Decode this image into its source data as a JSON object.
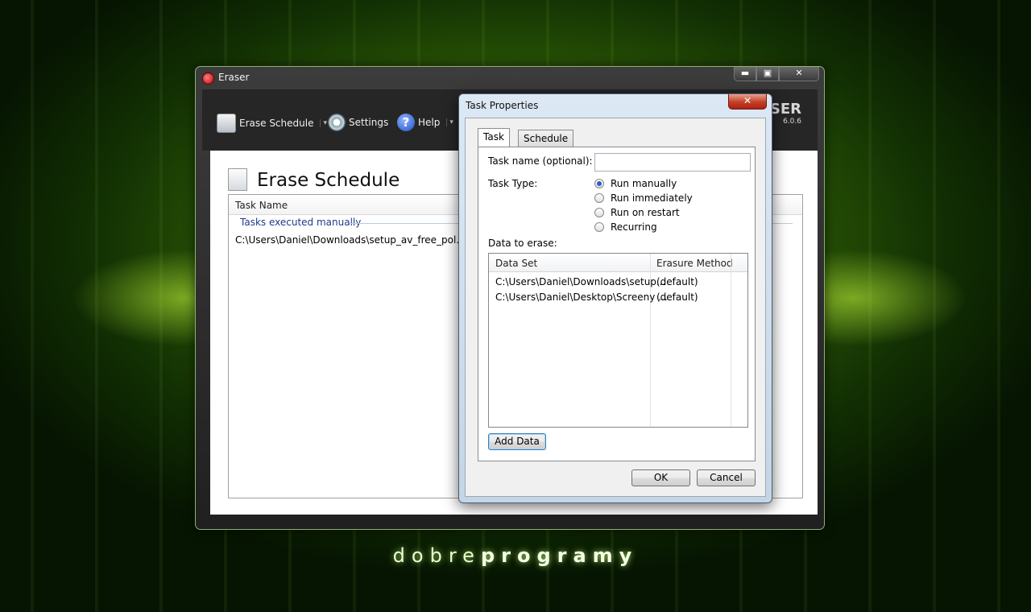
{
  "desktop": {
    "brand_light": "dobre",
    "brand_bold": "programy"
  },
  "main_window": {
    "title": "Eraser",
    "window_buttons": {
      "minimize": "▬",
      "maximize": "▣",
      "close": "✕"
    },
    "toolbar": {
      "erase_schedule": "Erase Schedule",
      "settings": "Settings",
      "help": "Help",
      "dropdown_arrow": "▾"
    },
    "logo": {
      "text": "ASER",
      "version": "6.0.6"
    },
    "page_title": "Erase Schedule",
    "list": {
      "column_task_name": "Task Name",
      "group_label": "Tasks executed manually",
      "rows": [
        "C:\\Users\\Daniel\\Downloads\\setup_av_free_pol.exe"
      ]
    }
  },
  "dialog": {
    "title": "Task Properties",
    "close": "✕",
    "tabs": [
      "Task",
      "Schedule"
    ],
    "task_name_label": "Task name (optional):",
    "task_name_value": "",
    "task_type_label": "Task Type:",
    "task_types": [
      "Run manually",
      "Run immediately",
      "Run on restart",
      "Recurring"
    ],
    "selected_task_type": "Run manually",
    "data_to_erase_label": "Data to erase:",
    "grid": {
      "columns": [
        "Data Set",
        "Erasure Method"
      ],
      "rows": [
        {
          "data_set": "C:\\Users\\Daniel\\Downloads\\setup...",
          "method": "(default)"
        },
        {
          "data_set": "C:\\Users\\Daniel\\Desktop\\Screeny ...",
          "method": "(default)"
        }
      ]
    },
    "add_data": "Add Data",
    "ok": "OK",
    "cancel": "Cancel"
  },
  "colors": {
    "desktop_green": "#2d5a06",
    "group_text": "#1e3a8a",
    "close_red": "#c24025"
  }
}
